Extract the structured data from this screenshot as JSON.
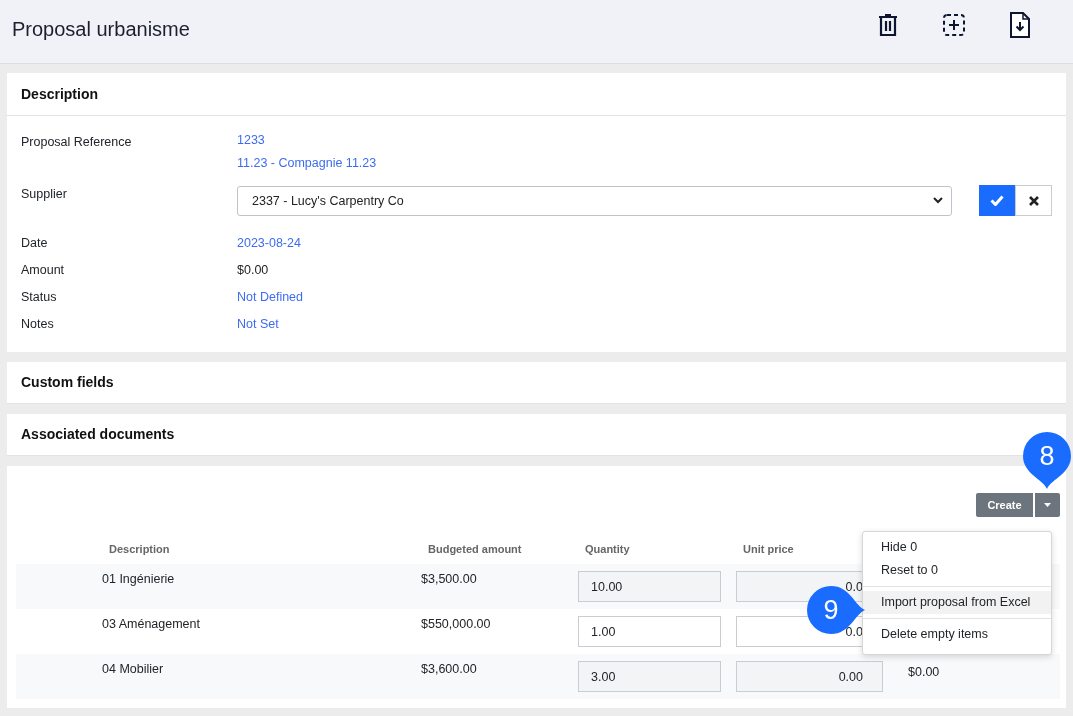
{
  "header": {
    "title": "Proposal urbanisme"
  },
  "description": {
    "heading": "Description",
    "fields": [
      {
        "label": "Proposal Reference",
        "kind": "links",
        "values": [
          "1233",
          "11.23 - Compagnie 11.23"
        ]
      },
      {
        "label": "Supplier",
        "kind": "select",
        "value": "2337 - Lucy's Carpentry Co"
      },
      {
        "label": "Date",
        "kind": "link",
        "value": "2023-08-24"
      },
      {
        "label": "Amount",
        "kind": "text",
        "value": "$0.00"
      },
      {
        "label": "Status",
        "kind": "link",
        "value": "Not Defined"
      },
      {
        "label": "Notes",
        "kind": "link",
        "value": "Not Set"
      }
    ]
  },
  "sections": [
    {
      "heading": "Custom fields"
    },
    {
      "heading": "Associated documents"
    }
  ],
  "items": {
    "create_button": "Create",
    "toggle_callout": "8",
    "columns": [
      "Description",
      "Budgeted amount",
      "Quantity",
      "Unit price"
    ],
    "rows": [
      {
        "description": "01 Ingénierie",
        "budgeted": "$3,500.00",
        "quantity": "10.00",
        "unit_price": "0.0"
      },
      {
        "description": "03 Aménagement",
        "budgeted": "$550,000.00",
        "quantity": "1.00",
        "unit_price": "0.0"
      },
      {
        "description": "04 Mobilier",
        "budgeted": "$3,600.00",
        "quantity": "3.00",
        "unit_price": "0.00",
        "column_5": "$0.00"
      }
    ]
  },
  "menu": {
    "groups": [
      [
        {
          "label": "Hide 0",
          "highlighted": false
        },
        {
          "label": "Reset to 0",
          "highlighted": false
        }
      ],
      [
        {
          "label": "Import proposal from Excel",
          "highlighted": true,
          "callout": "9"
        }
      ],
      [
        {
          "label": "Delete empty items",
          "highlighted": false
        }
      ]
    ]
  }
}
